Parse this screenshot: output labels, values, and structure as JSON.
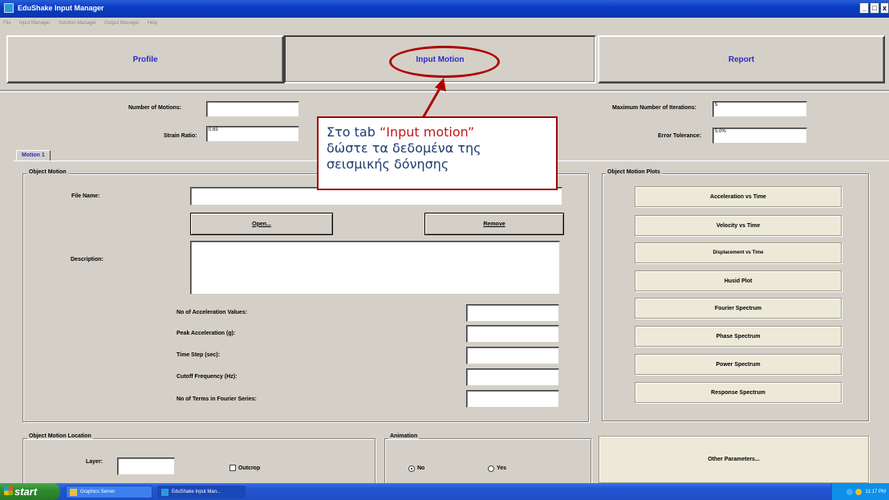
{
  "window": {
    "title": "EduShake Input Manager",
    "buttons": {
      "minimize": "_",
      "maximize": "□",
      "close": "x"
    }
  },
  "menu": [
    "File",
    "Input Manager",
    "Solution Manager",
    "Output Manager",
    "Help"
  ],
  "main_tabs": {
    "profile": "Profile",
    "input_motion": "Input Motion",
    "report": "Report"
  },
  "top_fields": {
    "number_of_motions": {
      "label": "Number of Motions:",
      "value": ""
    },
    "strain_ratio": {
      "label": "Strain Ratio:",
      "value": "0.65"
    },
    "max_iterations": {
      "label": "Maximum Number of Iterations:",
      "value": "5"
    },
    "error_tolerance": {
      "label": "Error Tolerance:",
      "value": "5.0%"
    }
  },
  "motion_tab": "Motion 1",
  "object_motion": {
    "title": "Object Motion",
    "file_name_label": "File Name:",
    "file_name_value": "",
    "open_button": "Open...",
    "remove_button": "Remove",
    "description_label": "Description:",
    "description_value": "",
    "fields": [
      {
        "label": "No of Acceleration Values:",
        "value": ""
      },
      {
        "label": "Peak Acceleration (g):",
        "value": ""
      },
      {
        "label": "Time Step (sec):",
        "value": ""
      },
      {
        "label": "Cutoff Frequency (Hz):",
        "value": ""
      },
      {
        "label": "No of Terms in Fourier Series:",
        "value": ""
      }
    ]
  },
  "object_motion_plots": {
    "title": "Object Motion Plots",
    "buttons": [
      "Acceleration vs Time",
      "Velocity vs Time",
      "Displacement vs Time",
      "Husid Plot",
      "Fourier Spectrum",
      "Phase Spectrum",
      "Power Spectrum",
      "Response Spectrum"
    ]
  },
  "location": {
    "title": "Object Motion Location",
    "layer_label": "Layer:",
    "layer_value": "",
    "outcrop_label": "Outcrop"
  },
  "animation": {
    "title": "Animation",
    "no_label": "No",
    "yes_label": "Yes",
    "selected": "No"
  },
  "other_parameters_button": "Other Parameters...",
  "annotation": {
    "line1_prefix": "Στο tab ",
    "line1_highlight": "“Input motion”",
    "line2": "δώστε τα δεδομένα της",
    "line3": "σεισμικής δόνησης"
  },
  "taskbar": {
    "start": "start",
    "tasks": [
      "Graphics Server",
      "EduShake Input Man..."
    ],
    "clock": "11:17 PM"
  }
}
